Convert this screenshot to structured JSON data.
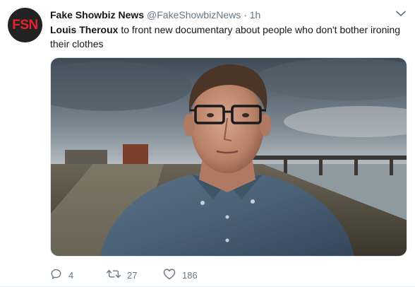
{
  "author": {
    "display_name": "Fake Showbiz News",
    "handle": "@FakeShowbizNews",
    "separator": "·",
    "time": "1h",
    "avatar_text": "FSN"
  },
  "tweet": {
    "subject": "Louis Theroux",
    "body": " to front new documentary about people who don't bother ironing their clothes"
  },
  "actions": {
    "reply_count": "4",
    "retweet_count": "27",
    "like_count": "186"
  },
  "icons": {
    "caret": "chevron-down-icon",
    "reply": "reply-icon",
    "retweet": "retweet-icon",
    "like": "heart-icon"
  },
  "colors": {
    "text": "#14171a",
    "secondary": "#657786",
    "logo_red": "#e8212e"
  }
}
